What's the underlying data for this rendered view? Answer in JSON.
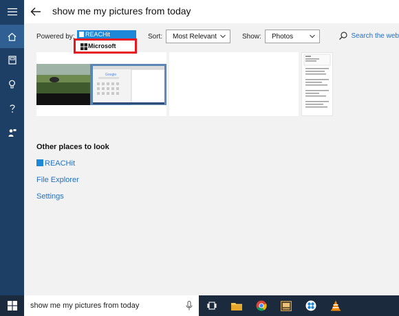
{
  "search": {
    "query": "show me my pictures from today"
  },
  "sidebar": {
    "items": [
      {
        "icon": "hamburger-menu-icon"
      },
      {
        "icon": "home-icon",
        "active": true
      },
      {
        "icon": "notebook-icon"
      },
      {
        "icon": "lightbulb-icon"
      },
      {
        "icon": "help-icon"
      },
      {
        "icon": "feedback-icon"
      }
    ]
  },
  "filters": {
    "powered_by_label": "Powered by:",
    "provider_selected": "REACHit",
    "provider_option": "Microsoft",
    "sort_label": "Sort:",
    "sort_value": "Most Relevant",
    "show_label": "Show:",
    "show_value": "Photos",
    "search_web": "Search the web"
  },
  "thumbnails": {
    "inner_page_title": "Google"
  },
  "other_places": {
    "title": "Other places to look",
    "items": [
      {
        "label": "REACHit"
      },
      {
        "label": "File Explorer"
      },
      {
        "label": "Settings"
      }
    ]
  },
  "taskbar": {
    "search_text": "show me my pictures from today",
    "apps": [
      "task-view-icon",
      "file-explorer-icon",
      "chrome-icon",
      "app-icon",
      "reachit-icon",
      "vlc-icon"
    ]
  },
  "colors": {
    "sidebar": "#1d3f66",
    "sidebar_active": "#2f5f93",
    "accent": "#1e88d8",
    "link": "#1f6fc5",
    "highlight": "#e8161f",
    "taskbar": "#1b2a3c"
  }
}
